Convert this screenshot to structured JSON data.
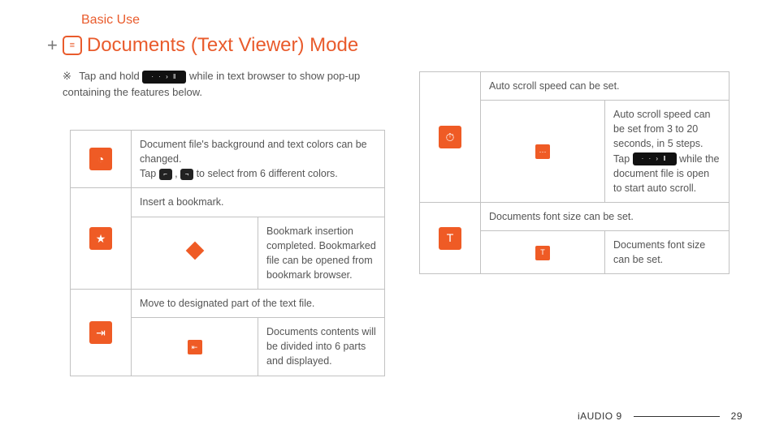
{
  "section_label": "Basic Use",
  "title_plus": "+",
  "title_icon_glyph": "≡",
  "title_text": "Documents (Text Viewer) Mode",
  "intro_marker": "※",
  "intro_before": "Tap and hold ",
  "intro_after": " while in text browser to show pop-up containing the features below.",
  "pill_glyph": "· · › ‖",
  "key_left_glyph": "⌐",
  "key_right_glyph": "¬",
  "left": {
    "r1": {
      "icon": "◔",
      "line1": "Document file's background and text colors can be changed.",
      "tap_before": "Tap ",
      "tap_mid": ", ",
      "tap_after": " to select from 6 different colors."
    },
    "r2": {
      "icon": "★",
      "header": "Insert a bookmark.",
      "sub_desc": "Bookmark insertion completed. Bookmarked file can be opened from bookmark browser."
    },
    "r3": {
      "icon": "⇥",
      "header": "Move to designated part of the text file.",
      "sub_icon": "⇤",
      "sub_desc": "Documents contents will be divided into 6 parts and displayed."
    }
  },
  "right": {
    "r1": {
      "icon": "⏱",
      "header": "Auto scroll speed can be set.",
      "sub_icon": "⋯",
      "sub_l1": "Auto scroll speed can be set from 3 to 20 seconds, in 5 steps.",
      "sub_l2_before": "Tap ",
      "sub_l2_after": " while the document file is open to start auto scroll."
    },
    "r2": {
      "icon": "T",
      "header": "Documents font size can be set.",
      "sub_icon": "T",
      "sub_desc": "Documents font size can be set."
    }
  },
  "footer_brand": "iAUDIO 9",
  "footer_page": "29"
}
